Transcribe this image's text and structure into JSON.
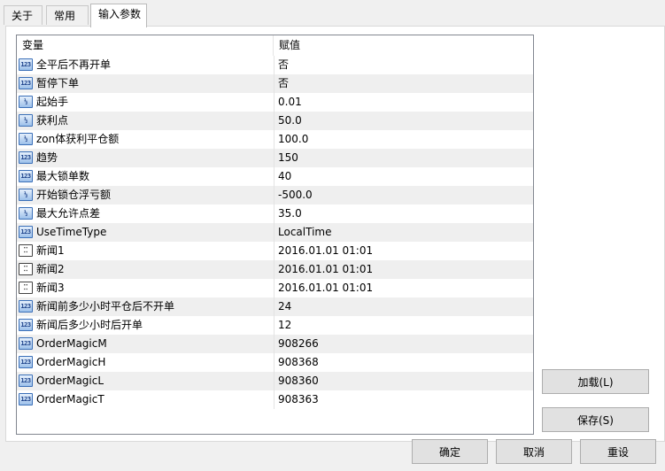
{
  "tabs": [
    {
      "label": "关于"
    },
    {
      "label": "常用"
    },
    {
      "label": "输入参数"
    }
  ],
  "grid": {
    "header_variable": "变量",
    "header_value": "赋值",
    "rows": [
      {
        "icon": "integer-type-icon",
        "badge": "123",
        "name": "全平后不再开单",
        "value": "否"
      },
      {
        "icon": "integer-type-icon",
        "badge": "123",
        "name": "暂停下单",
        "value": "否"
      },
      {
        "icon": "double-type-icon",
        "badge": "½",
        "name": "起始手",
        "value": "0.01"
      },
      {
        "icon": "double-type-icon",
        "badge": "½",
        "name": "获利点",
        "value": "50.0"
      },
      {
        "icon": "double-type-icon",
        "badge": "½",
        "name": "zon体获利平仓额",
        "value": "100.0"
      },
      {
        "icon": "integer-type-icon",
        "badge": "123",
        "name": "趋势",
        "value": "150"
      },
      {
        "icon": "integer-type-icon",
        "badge": "123",
        "name": "最大锁单数",
        "value": "40"
      },
      {
        "icon": "double-type-icon",
        "badge": "½",
        "name": "开始锁仓浮亏额",
        "value": "-500.0"
      },
      {
        "icon": "double-type-icon",
        "badge": "½",
        "name": "最大允许点差",
        "value": "35.0"
      },
      {
        "icon": "integer-type-icon",
        "badge": "123",
        "name": "UseTimeType",
        "value": "LocalTime"
      },
      {
        "icon": "datetime-type-icon",
        "badge": "⁚⁚",
        "name": "新闻1",
        "value": "2016.01.01 01:01"
      },
      {
        "icon": "datetime-type-icon",
        "badge": "⁚⁚",
        "name": "新闻2",
        "value": "2016.01.01 01:01"
      },
      {
        "icon": "datetime-type-icon",
        "badge": "⁚⁚",
        "name": "新闻3",
        "value": "2016.01.01 01:01"
      },
      {
        "icon": "integer-type-icon",
        "badge": "123",
        "name": "新闻前多少小时平仓后不开单",
        "value": "24"
      },
      {
        "icon": "integer-type-icon",
        "badge": "123",
        "name": "新闻后多少小时后开单",
        "value": "12"
      },
      {
        "icon": "integer-type-icon",
        "badge": "123",
        "name": "OrderMagicM",
        "value": "908266"
      },
      {
        "icon": "integer-type-icon",
        "badge": "123",
        "name": "OrderMagicH",
        "value": "908368"
      },
      {
        "icon": "integer-type-icon",
        "badge": "123",
        "name": "OrderMagicL",
        "value": "908360"
      },
      {
        "icon": "integer-type-icon",
        "badge": "123",
        "name": "OrderMagicT",
        "value": "908363"
      }
    ]
  },
  "buttons": {
    "load": "加载(L)",
    "save": "保存(S)",
    "ok": "确定",
    "cancel": "取消",
    "reset": "重设"
  }
}
